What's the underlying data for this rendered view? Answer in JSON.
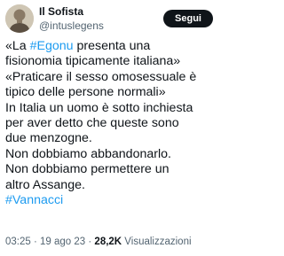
{
  "author": {
    "name": "Il Sofista",
    "handle": "@intuslegens"
  },
  "follow_button": {
    "label": "Segui"
  },
  "tweet": {
    "line1": {
      "pre": "«La ",
      "tag": "#Egonu",
      "post": " presenta una"
    },
    "line2": "fisionomia tipicamente italiana»",
    "line3": "«Praticare il sesso omosessuale è",
    "line4": "tipico delle persone normali»",
    "line5": "In Italia un uomo è sotto inchiesta",
    "line6": "per aver detto che queste sono",
    "line7": "due menzogne.",
    "line8": "Non dobbiamo abbandonarlo.",
    "line9": "Non dobbiamo permettere un",
    "line10": "altro Assange.",
    "line11_tag": "#Vannacci"
  },
  "meta": {
    "time": "03:25",
    "sep1": " · ",
    "date": "19 ago 23",
    "sep2": " · ",
    "views_count": "28,2K",
    "views_label": " Visualizzazioni"
  },
  "colors": {
    "link": "#1d9bf0",
    "text": "#0f1419",
    "secondary": "#536471",
    "button_bg": "#0f1419"
  }
}
